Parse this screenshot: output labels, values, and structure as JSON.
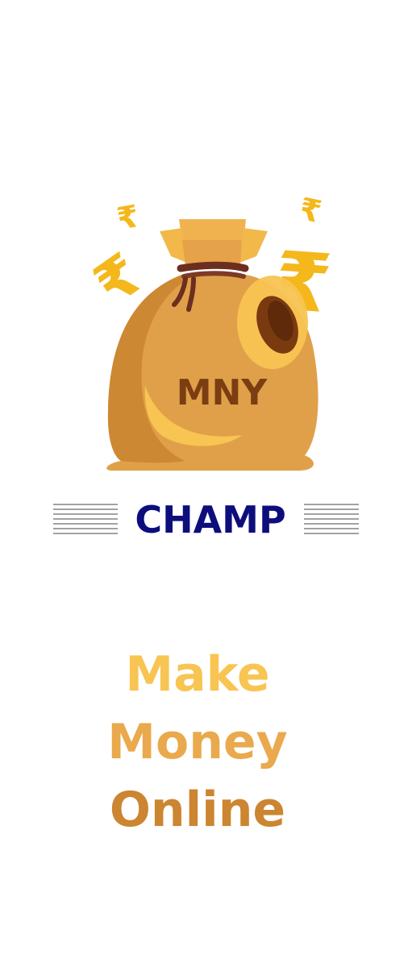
{
  "logo": {
    "bag_text": "MNY",
    "brand_name": "CHAMP",
    "coin_symbol": "₹",
    "colors": {
      "bag": "#E6A24A",
      "bag_dark": "#C9842F",
      "bag_light": "#F8C452",
      "rope": "#6B2E1F",
      "bag_text": "#7B3E12",
      "brand_text": "#0D0E7C",
      "rupee": "#F4B81C"
    }
  },
  "tagline": {
    "line1": "Make",
    "line2": "Money",
    "line3": "Online",
    "colors": [
      "#F8C452",
      "#E9A94C",
      "#CC8530"
    ]
  }
}
